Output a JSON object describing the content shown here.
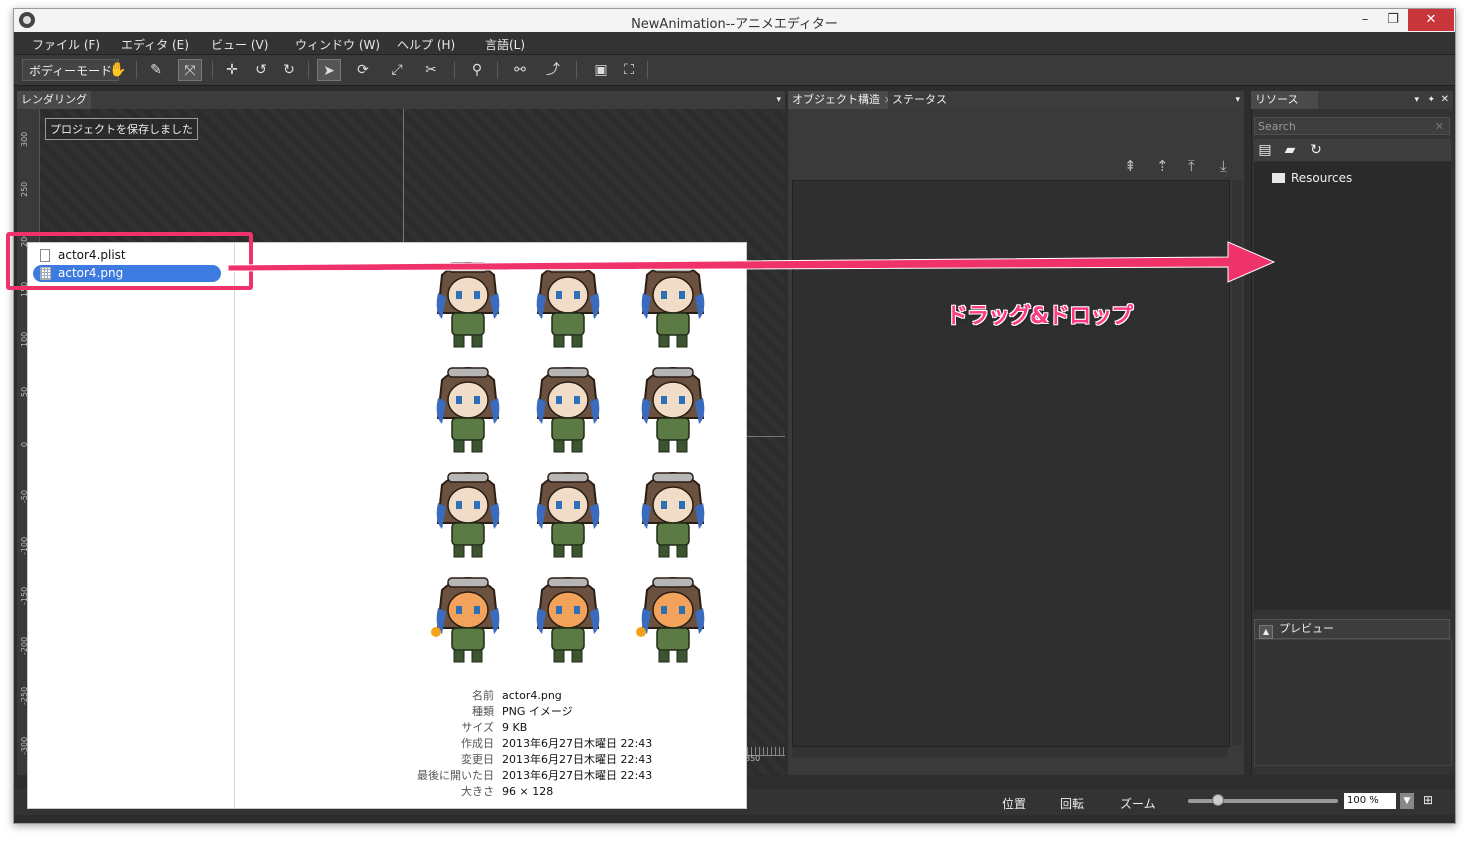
{
  "window": {
    "title": "NewAnimation--アニメエディター",
    "controls": {
      "minimize": "–",
      "restore": "❐",
      "close": "✕"
    }
  },
  "menu": [
    "ファイル (F)",
    "エディタ (E)",
    "ビュー (V)",
    "ウィンドウ (W)",
    "ヘルプ (H)",
    "言語(L)"
  ],
  "toolbar": {
    "mode_label": "ボディーモード"
  },
  "render_panel": {
    "title": "レンダリング",
    "save_message": "プロジェクトを保存しました",
    "ruler_labels": [
      "300",
      "250",
      "200",
      "150",
      "100",
      "50",
      "0",
      "-50",
      "-100",
      "-150",
      "-200",
      "-250",
      "-300"
    ],
    "bottom_ruler_label": "350"
  },
  "object_panel": {
    "tabs": [
      "オブジェクト構造",
      "ステータス"
    ]
  },
  "resources_panel": {
    "title": "リソース",
    "search_placeholder": "Search",
    "tree": [
      "Resources"
    ],
    "preview_title": "プレビュー"
  },
  "status_bar": {
    "position": "位置",
    "rotation": "回転",
    "zoom": "ズーム",
    "zoom_value": "100 %",
    "zoom_slider_fraction": 0.2
  },
  "finder": {
    "files": [
      {
        "name": "actor4.plist",
        "selected": false
      },
      {
        "name": "actor4.png",
        "selected": true
      }
    ],
    "info": [
      {
        "label": "名前",
        "value": "actor4.png"
      },
      {
        "label": "種類",
        "value": "PNG イメージ"
      },
      {
        "label": "サイズ",
        "value": "9 KB"
      },
      {
        "label": "作成日",
        "value": "2013年6月27日木曜日 22:43"
      },
      {
        "label": "変更日",
        "value": "2013年6月27日木曜日 22:43"
      },
      {
        "label": "最後に開いた日",
        "value": "2013年6月27日木曜日 22:43"
      },
      {
        "label": "大きさ",
        "value": "96 × 128"
      }
    ]
  },
  "annotation": {
    "label": "ドラッグ&ドロップ",
    "color": "#f0326a"
  }
}
